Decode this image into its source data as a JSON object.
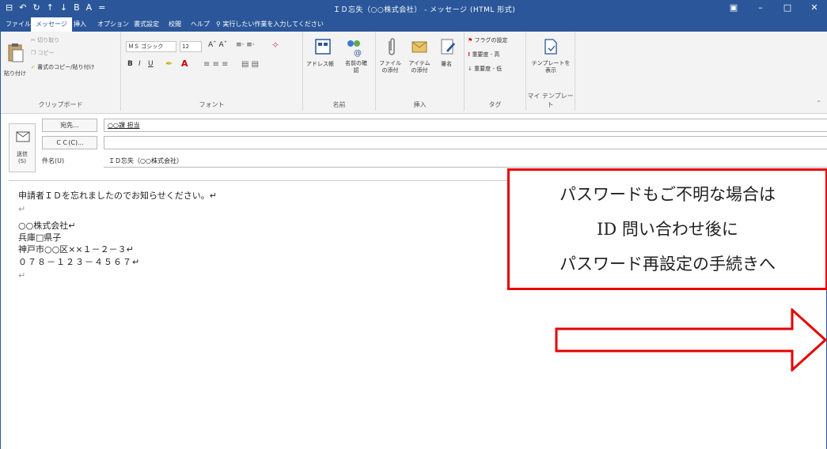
{
  "window": {
    "title": "ＩＤ忘失（○○株式会社） - メッセージ (HTML 形式)",
    "qat": [
      "⊟",
      "↶",
      "↻",
      "↑",
      "↓",
      "B",
      "A",
      "="
    ],
    "controls": [
      "▣",
      "–",
      "□",
      "✕"
    ]
  },
  "tabs": [
    "ファイル",
    "メッセージ",
    "挿入",
    "オプション",
    "書式設定",
    "校閲",
    "ヘルプ",
    "実行したい作業を入力してください"
  ],
  "ribbon": {
    "clipboard": {
      "label": "クリップボード",
      "paste": "貼り付け",
      "cut": "切り取り",
      "copy": "コピー",
      "format_painter": "書式のコピー/貼り付け"
    },
    "font": {
      "label": "フォント",
      "font_name": "ＭＳ ゴシック",
      "font_size": "12"
    },
    "names": {
      "label": "名前",
      "address_book": "アドレス帳",
      "check_names": "名前の確認"
    },
    "include": {
      "label": "挿入",
      "attach_file": "ファイルの添付",
      "attach_item": "アイテムの添付",
      "signature": "署名"
    },
    "tags": {
      "label": "タグ",
      "follow_up": "フラグの設定",
      "high_importance": "重要度 - 高",
      "low_importance": "重要度 - 低"
    },
    "templates": {
      "label": "マイ テンプレート",
      "view_templates": "テンプレートを表示"
    }
  },
  "compose": {
    "send": "送信\n(S)",
    "to_label": "宛先...",
    "to_value": "○○課 担当",
    "cc_label": "ＣＣ(C)...",
    "cc_value": "",
    "subject_label": "件名(U)",
    "subject_value": "ＩＤ忘失（○○株式会社）"
  },
  "body_lines": [
    "申請者ＩＤを忘れましたのでお知らせください。↵",
    "↵",
    "○○株式会社↵",
    "兵庫□県子",
    "神戸市○○区××１－２－３↵",
    "０７８－１２３－４５６７↵",
    "↵"
  ],
  "callout": {
    "lines": [
      "パスワードもご不明な場合は",
      "ID 問い合わせ後に",
      "パスワード再設定の手続きへ"
    ],
    "color": "#e60000"
  },
  "colors": {
    "accent": "#2b579a",
    "annotation": "#e60000"
  }
}
